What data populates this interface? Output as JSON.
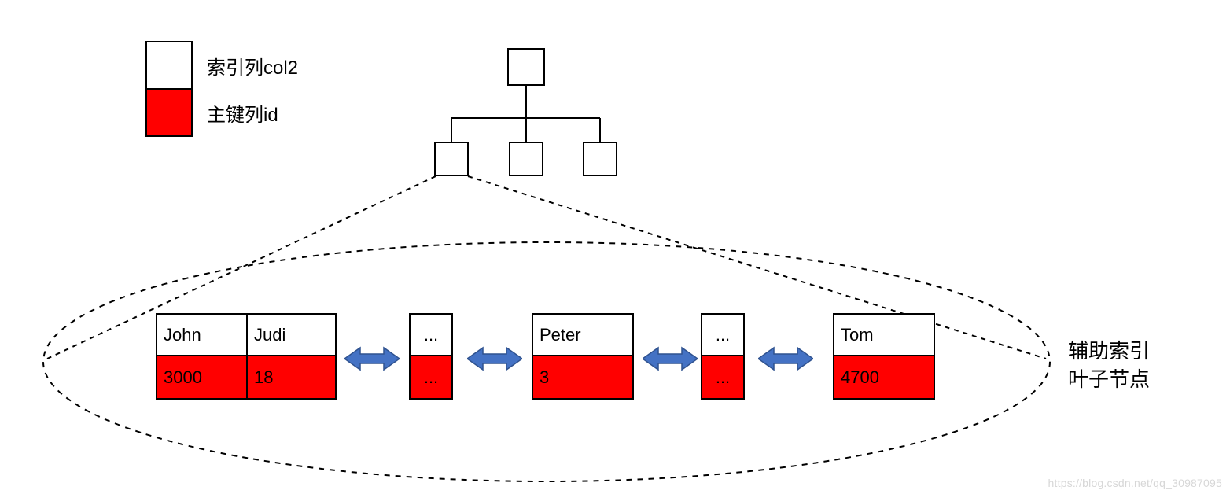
{
  "legend": {
    "index_col": "索引列col2",
    "pk_col": "主键列id"
  },
  "caption": {
    "line1": "辅助索引",
    "line2": "叶子节点"
  },
  "leaves": {
    "n0": {
      "col2_a": "John",
      "col2_b": "Judi",
      "id_a": "3000",
      "id_b": "18"
    },
    "n1": {
      "col2": "...",
      "id": "..."
    },
    "n2": {
      "col2": "Peter",
      "id": "3"
    },
    "n3": {
      "col2": "...",
      "id": "..."
    },
    "n4": {
      "col2": "Tom",
      "id": "4700"
    }
  },
  "watermark": "https://blog.csdn.net/qq_30987095",
  "chart_data": {
    "type": "diagram",
    "title": "辅助索引 叶子节点 (Secondary index leaf nodes)",
    "description": "A small B-tree: one root node, three intermediate child nodes, and an expanded (dashed-ellipse) view of the leaf level. Each leaf entry is two stacked cells: white top cell = secondary-index column col2 value, red bottom cell = primary-key id value. Leaf nodes are connected by blue double-headed arrows indicating a doubly-linked list.",
    "legend": [
      {
        "swatch": "white",
        "label": "索引列col2"
      },
      {
        "swatch": "red",
        "label": "主键列id"
      }
    ],
    "tree": {
      "root": 1,
      "children": 3
    },
    "leaf_nodes": [
      {
        "entries": [
          {
            "col2": "John",
            "id": 3000
          },
          {
            "col2": "Judi",
            "id": 18
          }
        ]
      },
      {
        "entries": [
          {
            "col2": "...",
            "id": "..."
          }
        ]
      },
      {
        "entries": [
          {
            "col2": "Peter",
            "id": 3
          }
        ]
      },
      {
        "entries": [
          {
            "col2": "...",
            "id": "..."
          }
        ]
      },
      {
        "entries": [
          {
            "col2": "Tom",
            "id": 4700
          }
        ]
      }
    ],
    "leaf_linkage": "doubly-linked (blue ↔ arrows between consecutive leaf nodes)"
  }
}
